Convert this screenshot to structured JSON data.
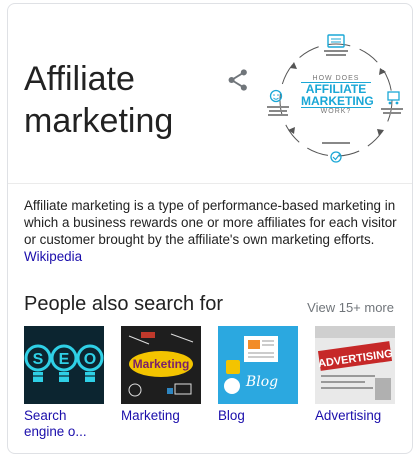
{
  "entity": {
    "title": "Affiliate marketing",
    "hero_text": {
      "how": "HOW DOES",
      "line1": "AFFILIATE",
      "line2": "MARKETING",
      "work": "WORK?"
    }
  },
  "description": {
    "text": "Affiliate marketing is a type of performance-based marketing in which a business rewards one or more affiliates for each visitor or customer brought by the affiliate's own marketing efforts. ",
    "source_link": "Wikipedia"
  },
  "people_also_search": {
    "heading": "People also search for",
    "more_link": "View 15+ more",
    "items": [
      {
        "label": "Search engine o...",
        "thumb_text": "SEO"
      },
      {
        "label": "Marketing",
        "thumb_text": "Marketing"
      },
      {
        "label": "Blog",
        "thumb_text": "Blog"
      },
      {
        "label": "Advertising",
        "thumb_text": "ADVERTISING"
      }
    ]
  },
  "icons": {
    "share": "share-icon"
  },
  "colors": {
    "link": "#1a0dab",
    "accent_blue": "#1aa7d6",
    "muted": "#70757a"
  }
}
